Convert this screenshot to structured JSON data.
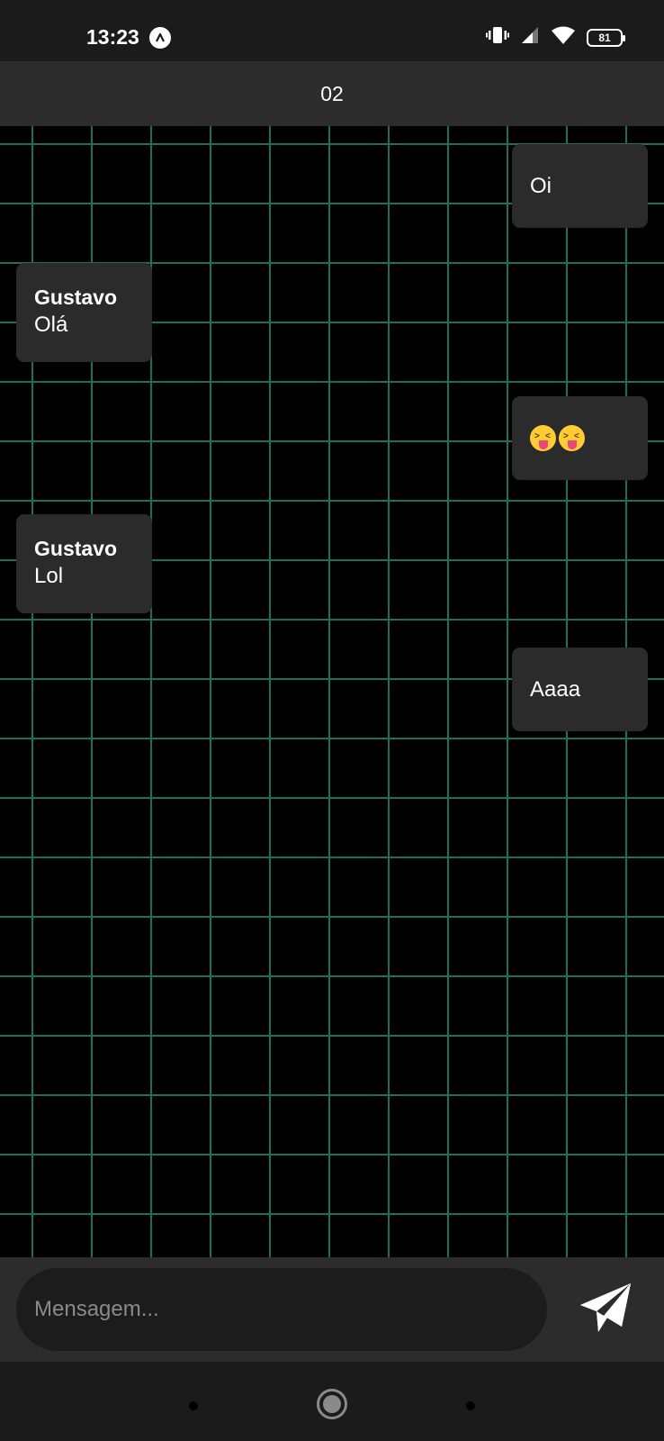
{
  "status_bar": {
    "time": "13:23",
    "battery": "81",
    "icons": [
      "app-notification-icon",
      "vibrate-icon",
      "cellular-signal-icon",
      "wifi-icon",
      "battery-icon"
    ]
  },
  "header": {
    "title": "02"
  },
  "messages": [
    {
      "direction": "outgoing",
      "text": "Oi"
    },
    {
      "direction": "incoming",
      "sender": "Gustavo",
      "text": "Olá"
    },
    {
      "direction": "outgoing",
      "emoji": [
        "squinting-face-with-tongue",
        "squinting-face-with-tongue"
      ]
    },
    {
      "direction": "incoming",
      "sender": "Gustavo",
      "text": "Lol"
    },
    {
      "direction": "outgoing",
      "text": "Aaaa"
    }
  ],
  "composer": {
    "placeholder": "Mensagem...",
    "send_icon": "paper-plane-icon"
  },
  "nav_bar": {
    "icons": [
      "recent-apps-icon",
      "home-icon",
      "back-icon"
    ]
  },
  "colors": {
    "background": "#000000",
    "grid_line": "#1e6f60",
    "bubble": "#2b2b2b",
    "header": "#2c2c2c",
    "input": "#1c1c1c"
  }
}
